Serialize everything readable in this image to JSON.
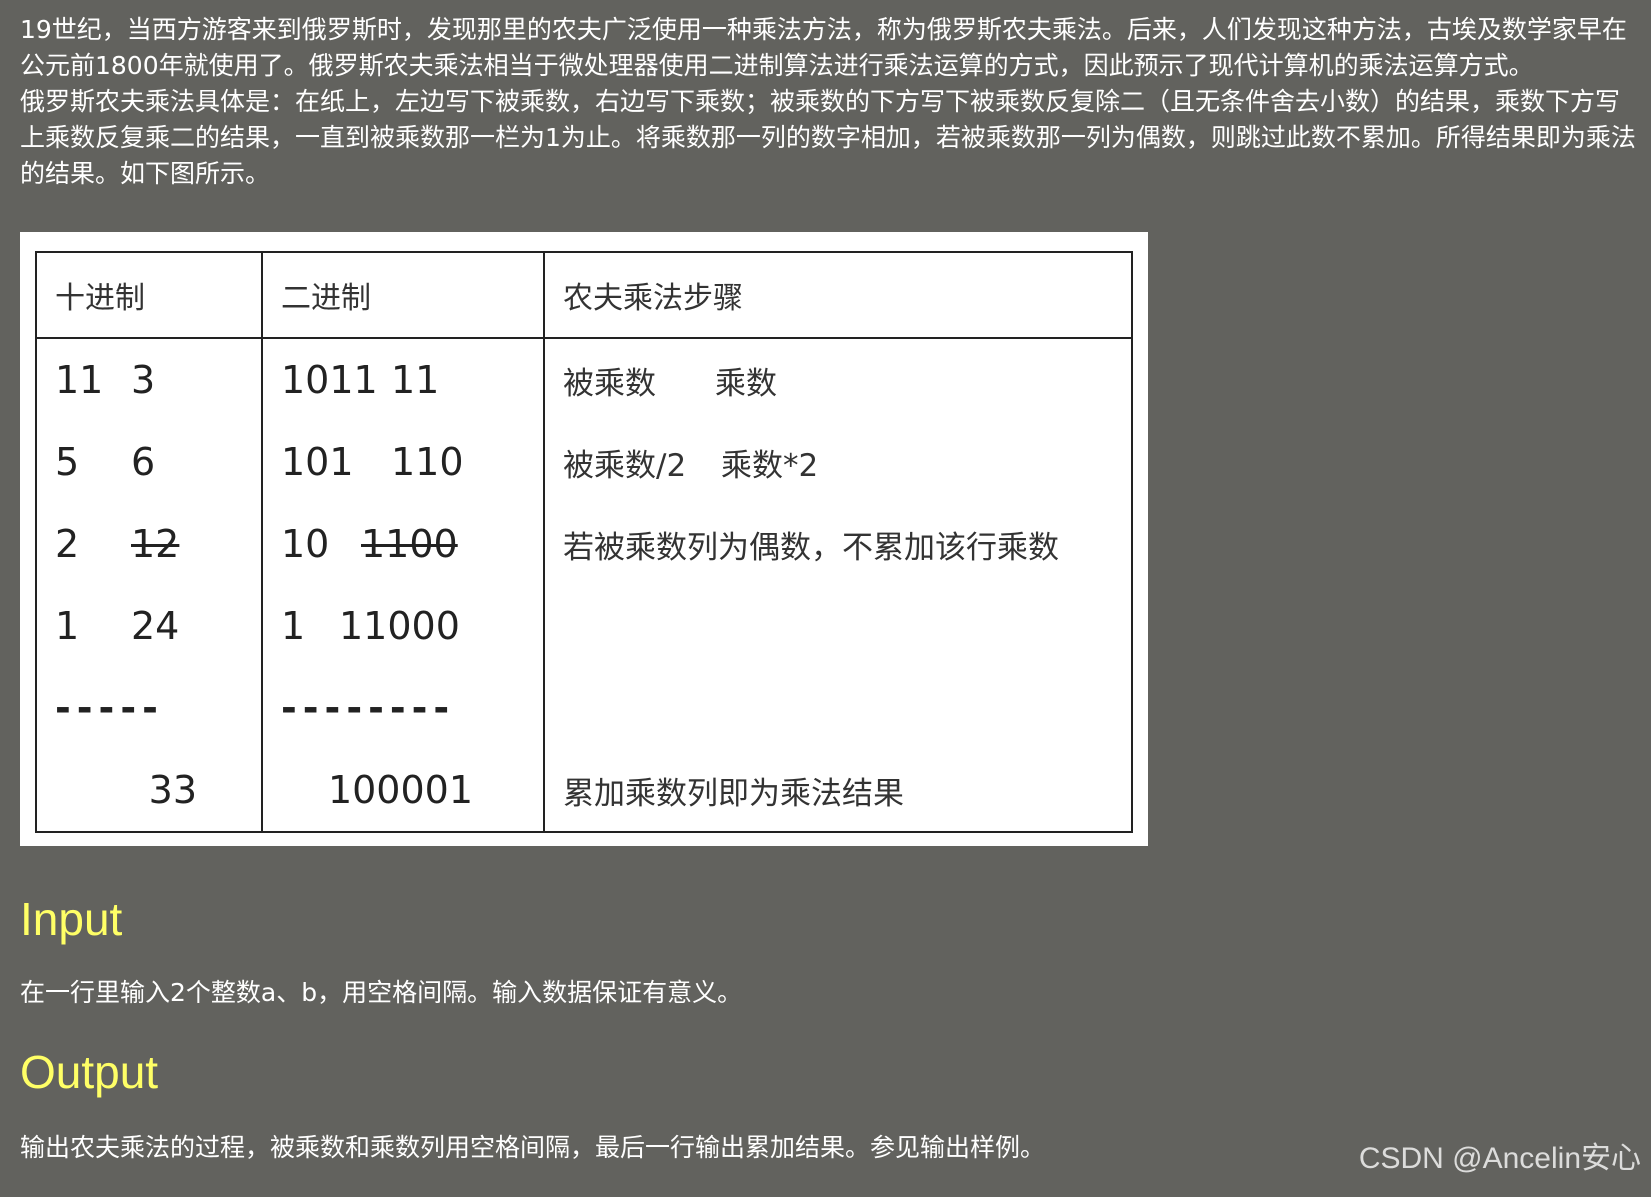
{
  "intro": {
    "paragraph1": "19世纪，当西方游客来到俄罗斯时，发现那里的农夫广泛使用一种乘法方法，称为俄罗斯农夫乘法。后来，人们发现这种方法，古埃及数学家早在公元前1800年就使用了。俄罗斯农夫乘法相当于微处理器使用二进制算法进行乘法运算的方式，因此预示了现代计算机的乘法运算方式。",
    "paragraph2": "俄罗斯农夫乘法具体是：在纸上，左边写下被乘数，右边写下乘数；被乘数的下方写下被乘数反复除二（且无条件舍去小数）的结果，乘数下方写上乘数反复乘二的结果，一直到被乘数那一栏为1为止。将乘数那一列的数字相加，若被乘数那一列为偶数，则跳过此数不累加。所得结果即为乘法的结果。如下图所示。"
  },
  "table": {
    "headers": [
      "十进制",
      "二进制",
      "农夫乘法步骤"
    ],
    "rows": [
      {
        "dec_a": "11",
        "dec_b": "3",
        "bin_a": "1011",
        "bin_b": "11",
        "step_a": "被乘数",
        "step_b": "乘数"
      },
      {
        "dec_a": "5",
        "dec_b": "6",
        "bin_a": "101",
        "bin_b": "110",
        "step_a": "被乘数/2",
        "step_b": "乘数*2"
      },
      {
        "dec_a": "2",
        "dec_b": "12",
        "bin_a": "10",
        "bin_b": "1100",
        "step_a": "若被乘数列为偶数，不累加该行乘数",
        "step_b": ""
      },
      {
        "dec_a": "1",
        "dec_b": "24",
        "bin_a": "1",
        "bin_b": "11000",
        "step_a": "",
        "step_b": ""
      }
    ],
    "dash_dec": "-----",
    "dash_bin": "--------",
    "result_dec": "33",
    "result_bin": "100001",
    "result_step": "累加乘数列即为乘法结果"
  },
  "input": {
    "title": "Input",
    "body": "在一行里输入2个整数a、b，用空格间隔。输入数据保证有意义。"
  },
  "output": {
    "title": "Output",
    "body": "输出农夫乘法的过程，被乘数和乘数列用空格间隔，最后一行输出累加结果。参见输出样例。"
  },
  "watermark": "CSDN @Ancelin安心"
}
